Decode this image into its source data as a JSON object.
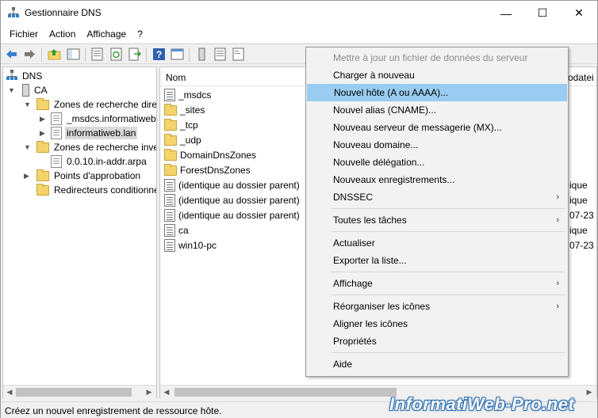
{
  "window": {
    "title": "Gestionnaire DNS",
    "minimize_glyph": "—",
    "maximize_glyph": "☐",
    "close_glyph": "✕"
  },
  "menubar": [
    "Fichier",
    "Action",
    "Affichage",
    "?"
  ],
  "toolbar": {
    "icons": [
      "back-icon",
      "forward-icon",
      "up-folder-icon",
      "show-tree-icon",
      "properties-icon",
      "refresh-icon",
      "export-icon",
      "help-icon",
      "console-icon",
      "server-icon",
      "list-icon",
      "records-icon"
    ]
  },
  "tree": {
    "dns": "DNS",
    "ca": "CA",
    "forward_zones": "Zones de recherche direc",
    "msdcs_zone": "_msdcs.informatiweb",
    "selected_zone": "informatiweb.lan",
    "reverse_zones": "Zones de recherche inver",
    "reverse_zone": "0.0.10.in-addr.arpa",
    "trust_points": "Points d'approbation",
    "forwarders": "Redirecteurs conditionne"
  },
  "list": {
    "column_name": "Nom",
    "column_extra": "rodatei",
    "rows": [
      {
        "name": "_msdcs",
        "side": ""
      },
      {
        "name": "_sites",
        "side": ""
      },
      {
        "name": "_tcp",
        "side": ""
      },
      {
        "name": "_udp",
        "side": ""
      },
      {
        "name": "DomainDnsZones",
        "side": ""
      },
      {
        "name": "ForestDnsZones",
        "side": ""
      },
      {
        "name": "(identique au dossier parent)",
        "side": "ique"
      },
      {
        "name": "(identique au dossier parent)",
        "side": "ique"
      },
      {
        "name": "(identique au dossier parent)",
        "side": "07-23 1"
      },
      {
        "name": "ca",
        "side": "ique"
      },
      {
        "name": "win10-pc",
        "side": "07-23 1"
      }
    ]
  },
  "context_menu": {
    "items": [
      {
        "label": "Mettre à jour un fichier de données du serveur",
        "disabled": true
      },
      {
        "label": "Charger à nouveau"
      },
      {
        "label": "Nouvel hôte (A ou AAAA)...",
        "highlighted": true
      },
      {
        "label": "Nouvel alias (CNAME)..."
      },
      {
        "label": "Nouveau serveur de messagerie (MX)..."
      },
      {
        "label": "Nouveau domaine..."
      },
      {
        "label": "Nouvelle délégation..."
      },
      {
        "label": "Nouveaux enregistrements..."
      },
      {
        "label": "DNSSEC",
        "submenu": true
      },
      {
        "label": "Toutes les tâches",
        "submenu": true
      },
      {
        "label": "Actualiser"
      },
      {
        "label": "Exporter la liste..."
      },
      {
        "label": "Affichage",
        "submenu": true
      },
      {
        "label": "Réorganiser les icônes",
        "submenu": true
      },
      {
        "label": "Aligner les icônes"
      },
      {
        "label": "Propriétés"
      },
      {
        "label": "Aide"
      }
    ],
    "submenu_glyph": "›"
  },
  "status": "Créez un nouvel enregistrement de ressource hôte.",
  "watermark": "InformatiWeb-Pro.net",
  "colors": {
    "highlight": "#99ccf0",
    "selection": "#d9d9d9",
    "folder": "#f3d36b",
    "watermark_outline": "#2f6fb0"
  }
}
